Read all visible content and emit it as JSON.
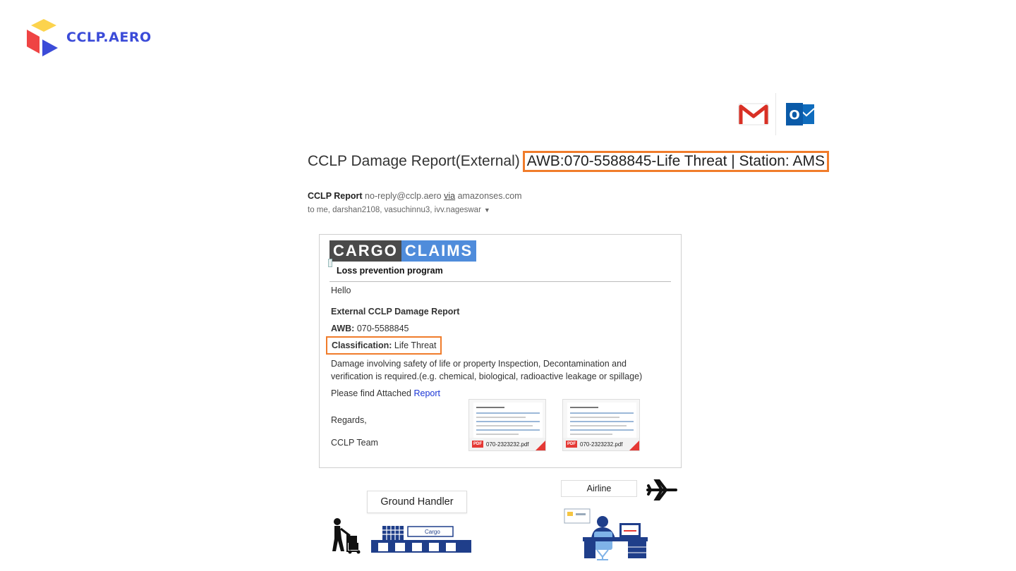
{
  "brand": {
    "name": "CCLP.AERO",
    "colors": {
      "yellow": "#fcd34d",
      "red": "#ef4444",
      "blue": "#3b4bd8"
    }
  },
  "mail_clients": [
    {
      "icon": "gmail-icon"
    },
    {
      "icon": "outlook-icon",
      "letter": "O"
    }
  ],
  "email": {
    "subject_prefix": "CCLP Damage Report(External)",
    "subject_highlight": "AWB:070-5588845-Life Threat | Station: AMS",
    "sender_name": "CCLP Report",
    "sender_email": "no-reply@cclp.aero",
    "sender_via_label": "via",
    "sender_domain": "amazonses.com",
    "recipients": "to me, darshan2108, vasuchinnu3, ivv.nageswar",
    "body": {
      "logo_cargo": "CARGO",
      "logo_claims": "CLAIMS",
      "logo_tagline": "Loss prevention program",
      "greeting": "Hello",
      "report_title": "External CCLP Damage Report",
      "awb_label": "AWB:",
      "awb_value": "070-5588845",
      "classification_label": "Classification:",
      "classification_value": "Life Threat",
      "description": "Damage involving safety of life or property Inspection, Decontamination and verification is required.(e.g. chemical, biological, radioactive leakage or spillage)",
      "attached_prefix": "Please find Attached",
      "attached_link": "Report",
      "regards": "Regards,",
      "team": "CCLP Team"
    },
    "attachments": [
      {
        "name": "070-2323232.pdf",
        "type": "PDF"
      },
      {
        "name": "070-2323232.pdf",
        "type": "PDF"
      }
    ]
  },
  "illustrations": {
    "ground_handler_label": "Ground Handler",
    "airline_label": "Airline",
    "warehouse_sign": "Cargo"
  },
  "colors": {
    "highlight": "#f07c2b",
    "link": "#1a35d6",
    "illustration": "#1f3e8a"
  }
}
